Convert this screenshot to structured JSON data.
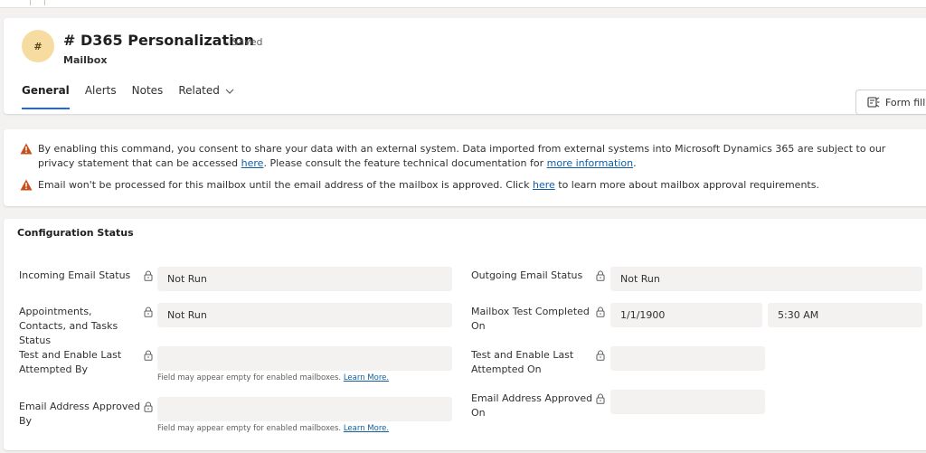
{
  "header": {
    "avatar_initial": "#",
    "title": "# D365 Personalization",
    "save_status": "- Saved",
    "entity": "Mailbox",
    "tabs": [
      {
        "label": "General"
      },
      {
        "label": "Alerts"
      },
      {
        "label": "Notes"
      },
      {
        "label": "Related"
      }
    ],
    "form_fill_label": "Form fill"
  },
  "notifications": [
    {
      "icon": "warning-icon",
      "before": "By enabling this command, you consent to share your data with an external system. Data imported from external systems into Microsoft Dynamics 365 are subject to our privacy statement that can be accessed ",
      "link1": "here",
      "middle": ". Please consult the feature technical documentation for ",
      "link2": "more information",
      "after": "."
    },
    {
      "icon": "warning-icon",
      "before": "Email won't be processed for this mailbox until the email address of the mailbox is approved. Click ",
      "link1": "here",
      "after": " to learn more about mailbox approval requirements."
    }
  ],
  "config": {
    "title": "Configuration Status",
    "hint_text": "Field may appear empty for enabled mailboxes.",
    "hint_link": "Learn More.",
    "left": [
      {
        "label": "Incoming Email Status",
        "value": "Not Run"
      },
      {
        "label": "Appointments, Contacts, and Tasks Status",
        "value": "Not Run"
      },
      {
        "label": "Test and Enable Last Attempted By",
        "value": ""
      },
      {
        "label": "Email Address Approved By",
        "value": ""
      }
    ],
    "right": [
      {
        "label": "Outgoing Email Status",
        "value": "Not Run"
      },
      {
        "label": "Mailbox Test Completed On",
        "date": "1/1/1900",
        "time": "5:30 AM"
      },
      {
        "label": "Test and Enable Last Attempted On",
        "value": ""
      },
      {
        "label": "Email Address Approved On",
        "value": ""
      }
    ]
  },
  "colors": {
    "accent": "#2266e3",
    "link": "#115ea3",
    "warning": "#c4501b",
    "avatar_bg": "#f7dca1"
  }
}
